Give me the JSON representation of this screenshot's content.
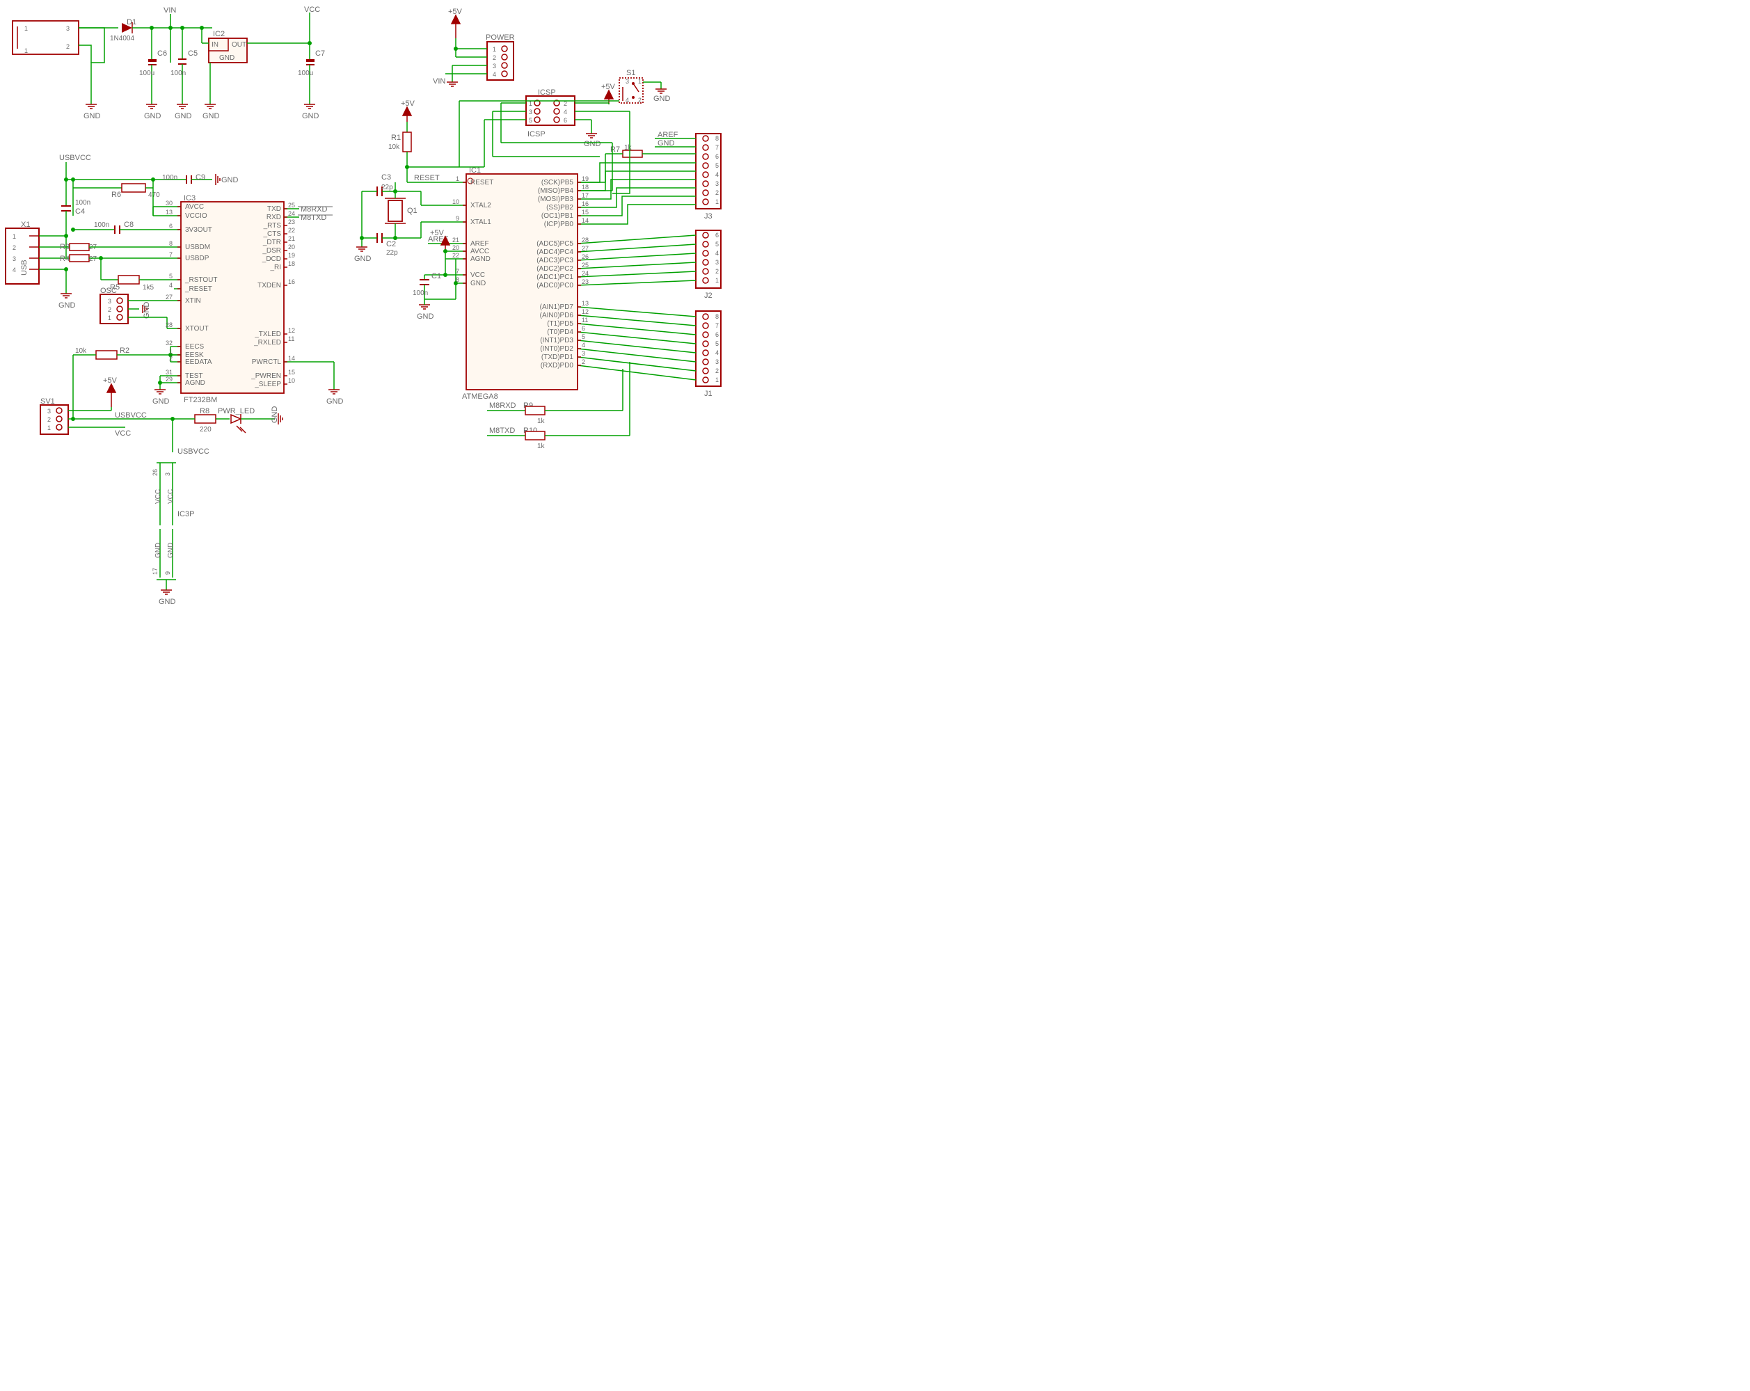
{
  "power": {
    "vin": "VIN",
    "vcc": "VCC",
    "v5": "+5V",
    "gnd": "GND",
    "usbvcc": "USBVCC",
    "aref": "AREF"
  },
  "diode": {
    "name": "D1",
    "value": "1N4004"
  },
  "caps": {
    "c1": {
      "name": "C1",
      "value": "100n"
    },
    "c2": {
      "name": "C2",
      "value": "22p"
    },
    "c3": {
      "name": "C3",
      "value": "22p"
    },
    "c4": {
      "name": "C4",
      "value": "100n"
    },
    "c5": {
      "name": "C5",
      "value": "100n"
    },
    "c6": {
      "name": "C6",
      "value": "100u"
    },
    "c7": {
      "name": "C7",
      "value": "100u"
    },
    "c8": {
      "name": "C8",
      "value": "100n"
    },
    "c9": {
      "name": "C9",
      "value": "100n"
    }
  },
  "resistors": {
    "r1": {
      "name": "R1",
      "value": "10k"
    },
    "r2": {
      "name": "R2",
      "value": "10k"
    },
    "r3": {
      "name": "R3",
      "value": "27"
    },
    "r4": {
      "name": "R4",
      "value": "27"
    },
    "r5": {
      "name": "R5",
      "value": "1k5"
    },
    "r6": {
      "name": "R6",
      "value": "470"
    },
    "r7": {
      "name": "R7",
      "value": "1k"
    },
    "r8": {
      "name": "R8",
      "value": "220"
    },
    "r9": {
      "name": "R9",
      "value": "1k"
    },
    "r10": {
      "name": "R10",
      "value": "1k"
    }
  },
  "ic1": {
    "ref": "IC1",
    "value": "ATMEGA8",
    "left": [
      {
        "num": "1",
        "label": "RESET"
      },
      {
        "num": "10",
        "label": "XTAL2"
      },
      {
        "num": "9",
        "label": "XTAL1"
      },
      {
        "num": "21",
        "label": "AREF"
      },
      {
        "num": "20",
        "label": "AVCC"
      },
      {
        "num": "22",
        "label": "AGND"
      },
      {
        "num": "7",
        "label": "VCC"
      },
      {
        "num": "8",
        "label": "GND"
      }
    ],
    "right": [
      {
        "num": "19",
        "label": "(SCK)PB5"
      },
      {
        "num": "18",
        "label": "(MISO)PB4"
      },
      {
        "num": "17",
        "label": "(MOSI)PB3"
      },
      {
        "num": "16",
        "label": "(SS)PB2"
      },
      {
        "num": "15",
        "label": "(OC1)PB1"
      },
      {
        "num": "14",
        "label": "(ICP)PB0"
      },
      {
        "num": "28",
        "label": "(ADC5)PC5"
      },
      {
        "num": "27",
        "label": "(ADC4)PC4"
      },
      {
        "num": "26",
        "label": "(ADC3)PC3"
      },
      {
        "num": "25",
        "label": "(ADC2)PC2"
      },
      {
        "num": "24",
        "label": "(ADC1)PC1"
      },
      {
        "num": "23",
        "label": "(ADC0)PC0"
      },
      {
        "num": "13",
        "label": "(AIN1)PD7"
      },
      {
        "num": "12",
        "label": "(AIN0)PD6"
      },
      {
        "num": "11",
        "label": "(T1)PD5"
      },
      {
        "num": "6",
        "label": "(T0)PD4"
      },
      {
        "num": "5",
        "label": "(INT1)PD3"
      },
      {
        "num": "4",
        "label": "(INT0)PD2"
      },
      {
        "num": "3",
        "label": "(TXD)PD1"
      },
      {
        "num": "2",
        "label": "(RXD)PD0"
      }
    ]
  },
  "ic2": {
    "ref": "IC2",
    "in": "IN",
    "out": "OUT",
    "gnd": "GND"
  },
  "ic3": {
    "ref": "IC3",
    "value": "FT232BM",
    "left": [
      {
        "num": "30",
        "label": "AVCC"
      },
      {
        "num": "13",
        "label": "VCCIO"
      },
      {
        "num": "6",
        "label": "3V3OUT"
      },
      {
        "num": "8",
        "label": "USBDM"
      },
      {
        "num": "7",
        "label": "USBDP"
      },
      {
        "num": "5",
        "label": "_RSTOUT"
      },
      {
        "num": "4",
        "label": "_RESET"
      },
      {
        "num": "27",
        "label": "XTIN"
      },
      {
        "num": "28",
        "label": "XTOUT"
      },
      {
        "num": "32",
        "label": "EECS"
      },
      {
        "num": "1",
        "label": "EESK"
      },
      {
        "num": "2",
        "label": "EEDATA"
      },
      {
        "num": "31",
        "label": "TEST"
      },
      {
        "num": "29",
        "label": "AGND"
      }
    ],
    "right": [
      {
        "num": "25",
        "label": "TXD"
      },
      {
        "num": "24",
        "label": "RXD"
      },
      {
        "num": "23",
        "label": "_RTS"
      },
      {
        "num": "22",
        "label": "_CTS"
      },
      {
        "num": "21",
        "label": "_DTR"
      },
      {
        "num": "20",
        "label": "_DSR"
      },
      {
        "num": "19",
        "label": "_DCD"
      },
      {
        "num": "18",
        "label": "_RI"
      },
      {
        "num": "16",
        "label": "TXDEN"
      },
      {
        "num": "12",
        "label": "_TXLED"
      },
      {
        "num": "11",
        "label": "_RXLED"
      },
      {
        "num": "14",
        "label": "PWRCTL"
      },
      {
        "num": "15",
        "label": "_PWREN"
      },
      {
        "num": "10",
        "label": "_SLEEP"
      }
    ]
  },
  "ic3p": {
    "ref": "IC3P",
    "vcc": "VCC",
    "gnd": "GND",
    "pins": [
      "26",
      "3",
      "17",
      "9"
    ]
  },
  "headers": {
    "power": {
      "name": "POWER",
      "pins": 4
    },
    "icsp": {
      "name": "ICSP",
      "pins": 6,
      "label2": "ICSP"
    },
    "j1": {
      "name": "J1",
      "pins": 8
    },
    "j2": {
      "name": "J2",
      "pins": 6
    },
    "j3": {
      "name": "J3",
      "pins": 8
    },
    "osc": {
      "name": "OSC",
      "pins": 3
    },
    "sv1": {
      "name": "SV1",
      "pins": 3
    },
    "x1": {
      "name": "X1",
      "label": "USB"
    }
  },
  "misc": {
    "q1": "Q1",
    "s1": "S1",
    "pwr_led": "PWR_LED",
    "m8rxd": "M8RXD",
    "m8txd": "M8TXD",
    "reset": "RESET"
  }
}
